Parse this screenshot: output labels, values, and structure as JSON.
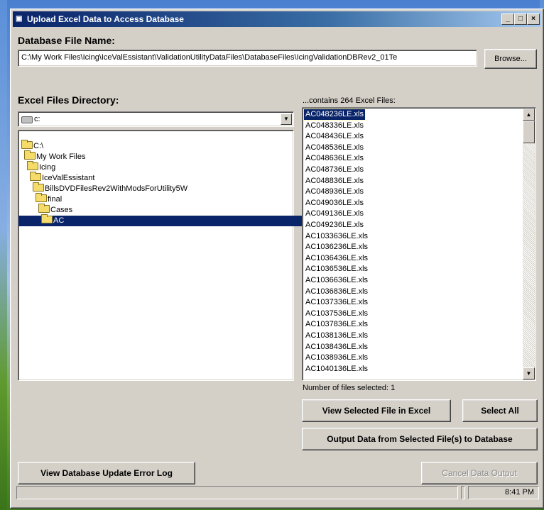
{
  "window": {
    "title": "Upload Excel Data to Access Database",
    "minimize": "_",
    "maximize": "□",
    "close": "×"
  },
  "database": {
    "label": "Database File Name:",
    "path": "C:\\My Work Files\\Icing\\IceValEssistant\\ValidationUtilityDataFiles\\DatabaseFiles\\IcingValidationDBRev2_01Te",
    "browse_label": "Browse..."
  },
  "excel_dir": {
    "label": "Excel Files Directory:",
    "drive": "c:",
    "folders": [
      {
        "name": "C:\\",
        "level": 0
      },
      {
        "name": "My Work Files",
        "level": 1
      },
      {
        "name": "Icing",
        "level": 2
      },
      {
        "name": "IceValEssistant",
        "level": 3
      },
      {
        "name": "BillsDVDFilesRev2WithModsForUtility5W",
        "level": 4
      },
      {
        "name": "final",
        "level": 5
      },
      {
        "name": "Cases",
        "level": 6
      },
      {
        "name": "AC",
        "level": 7,
        "selected": true
      }
    ]
  },
  "files": {
    "header": "...contains 264 Excel Files:",
    "items": [
      "AC048236LE.xls",
      "AC048336LE.xls",
      "AC048436LE.xls",
      "AC048536LE.xls",
      "AC048636LE.xls",
      "AC048736LE.xls",
      "AC048836LE.xls",
      "AC048936LE.xls",
      "AC049036LE.xls",
      "AC049136LE.xls",
      "AC049236LE.xls",
      "AC1033636LE.xls",
      "AC1036236LE.xls",
      "AC1036436LE.xls",
      "AC1036536LE.xls",
      "AC1036636LE.xls",
      "AC1036836LE.xls",
      "AC1037336LE.xls",
      "AC1037536LE.xls",
      "AC1037836LE.xls",
      "AC1038136LE.xls",
      "AC1038436LE.xls",
      "AC1038936LE.xls",
      "AC1040136LE.xls"
    ],
    "selected_index": 0,
    "selected_count_text": "Number of files selected:  1"
  },
  "buttons": {
    "view_in_excel": "View Selected File in Excel",
    "select_all": "Select All",
    "output_data": "Output Data from Selected File(s) to Database",
    "view_error_log": "View Database Update Error Log",
    "cancel_output": "Cancel Data Output"
  },
  "status": {
    "time": "8:41 PM"
  }
}
